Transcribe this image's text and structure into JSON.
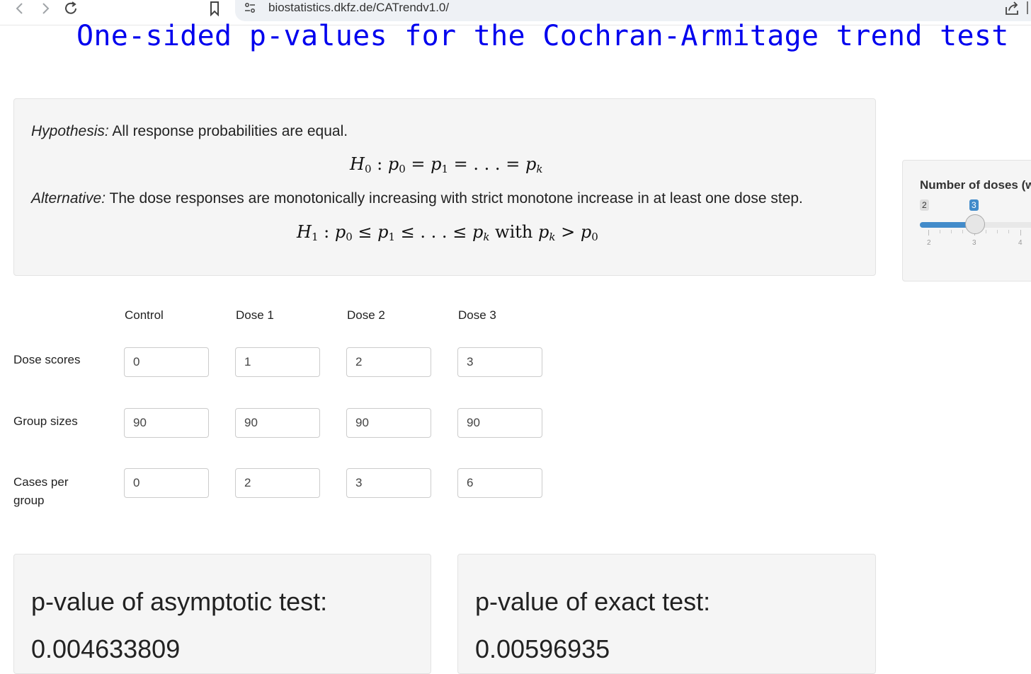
{
  "browser": {
    "back_icon": "chevron-left-icon",
    "forward_icon": "chevron-right-icon",
    "reload_icon": "reload-icon",
    "bookmark_icon": "bookmark-icon",
    "url": "biostatistics.dkfz.de/CATrendv1.0/"
  },
  "page": {
    "title": "One-sided p-values for the Cochran-Armitage trend test"
  },
  "hypothesis": {
    "label": "Hypothesis:",
    "text": " All response probabilities are equal.",
    "alt_label": "Alternative:",
    "alt_text": " The dose responses are monotonically increasing with strict monotone increase in at least one dose step."
  },
  "slider": {
    "label": "Number of doses (w",
    "min_badge": "2",
    "value": "3",
    "tick_labels": [
      "2",
      "3",
      "4"
    ]
  },
  "table": {
    "columns": [
      "Control",
      "Dose 1",
      "Dose 2",
      "Dose 3"
    ],
    "rows": [
      {
        "label": "Dose scores",
        "values": [
          "0",
          "1",
          "2",
          "3"
        ]
      },
      {
        "label": "Group sizes",
        "values": [
          "90",
          "90",
          "90",
          "90"
        ]
      },
      {
        "label": "Cases per group",
        "values": [
          "0",
          "2",
          "3",
          "6"
        ]
      }
    ]
  },
  "results": {
    "asymptotic_label": "p-value of asymptotic test:",
    "asymptotic_value": "0.004633809",
    "exact_label": "p-value of exact test:",
    "exact_value": "0.00596935"
  },
  "colors": {
    "title": "#0000ee",
    "accent": "#428bca",
    "panel_bg": "#f5f5f5"
  }
}
